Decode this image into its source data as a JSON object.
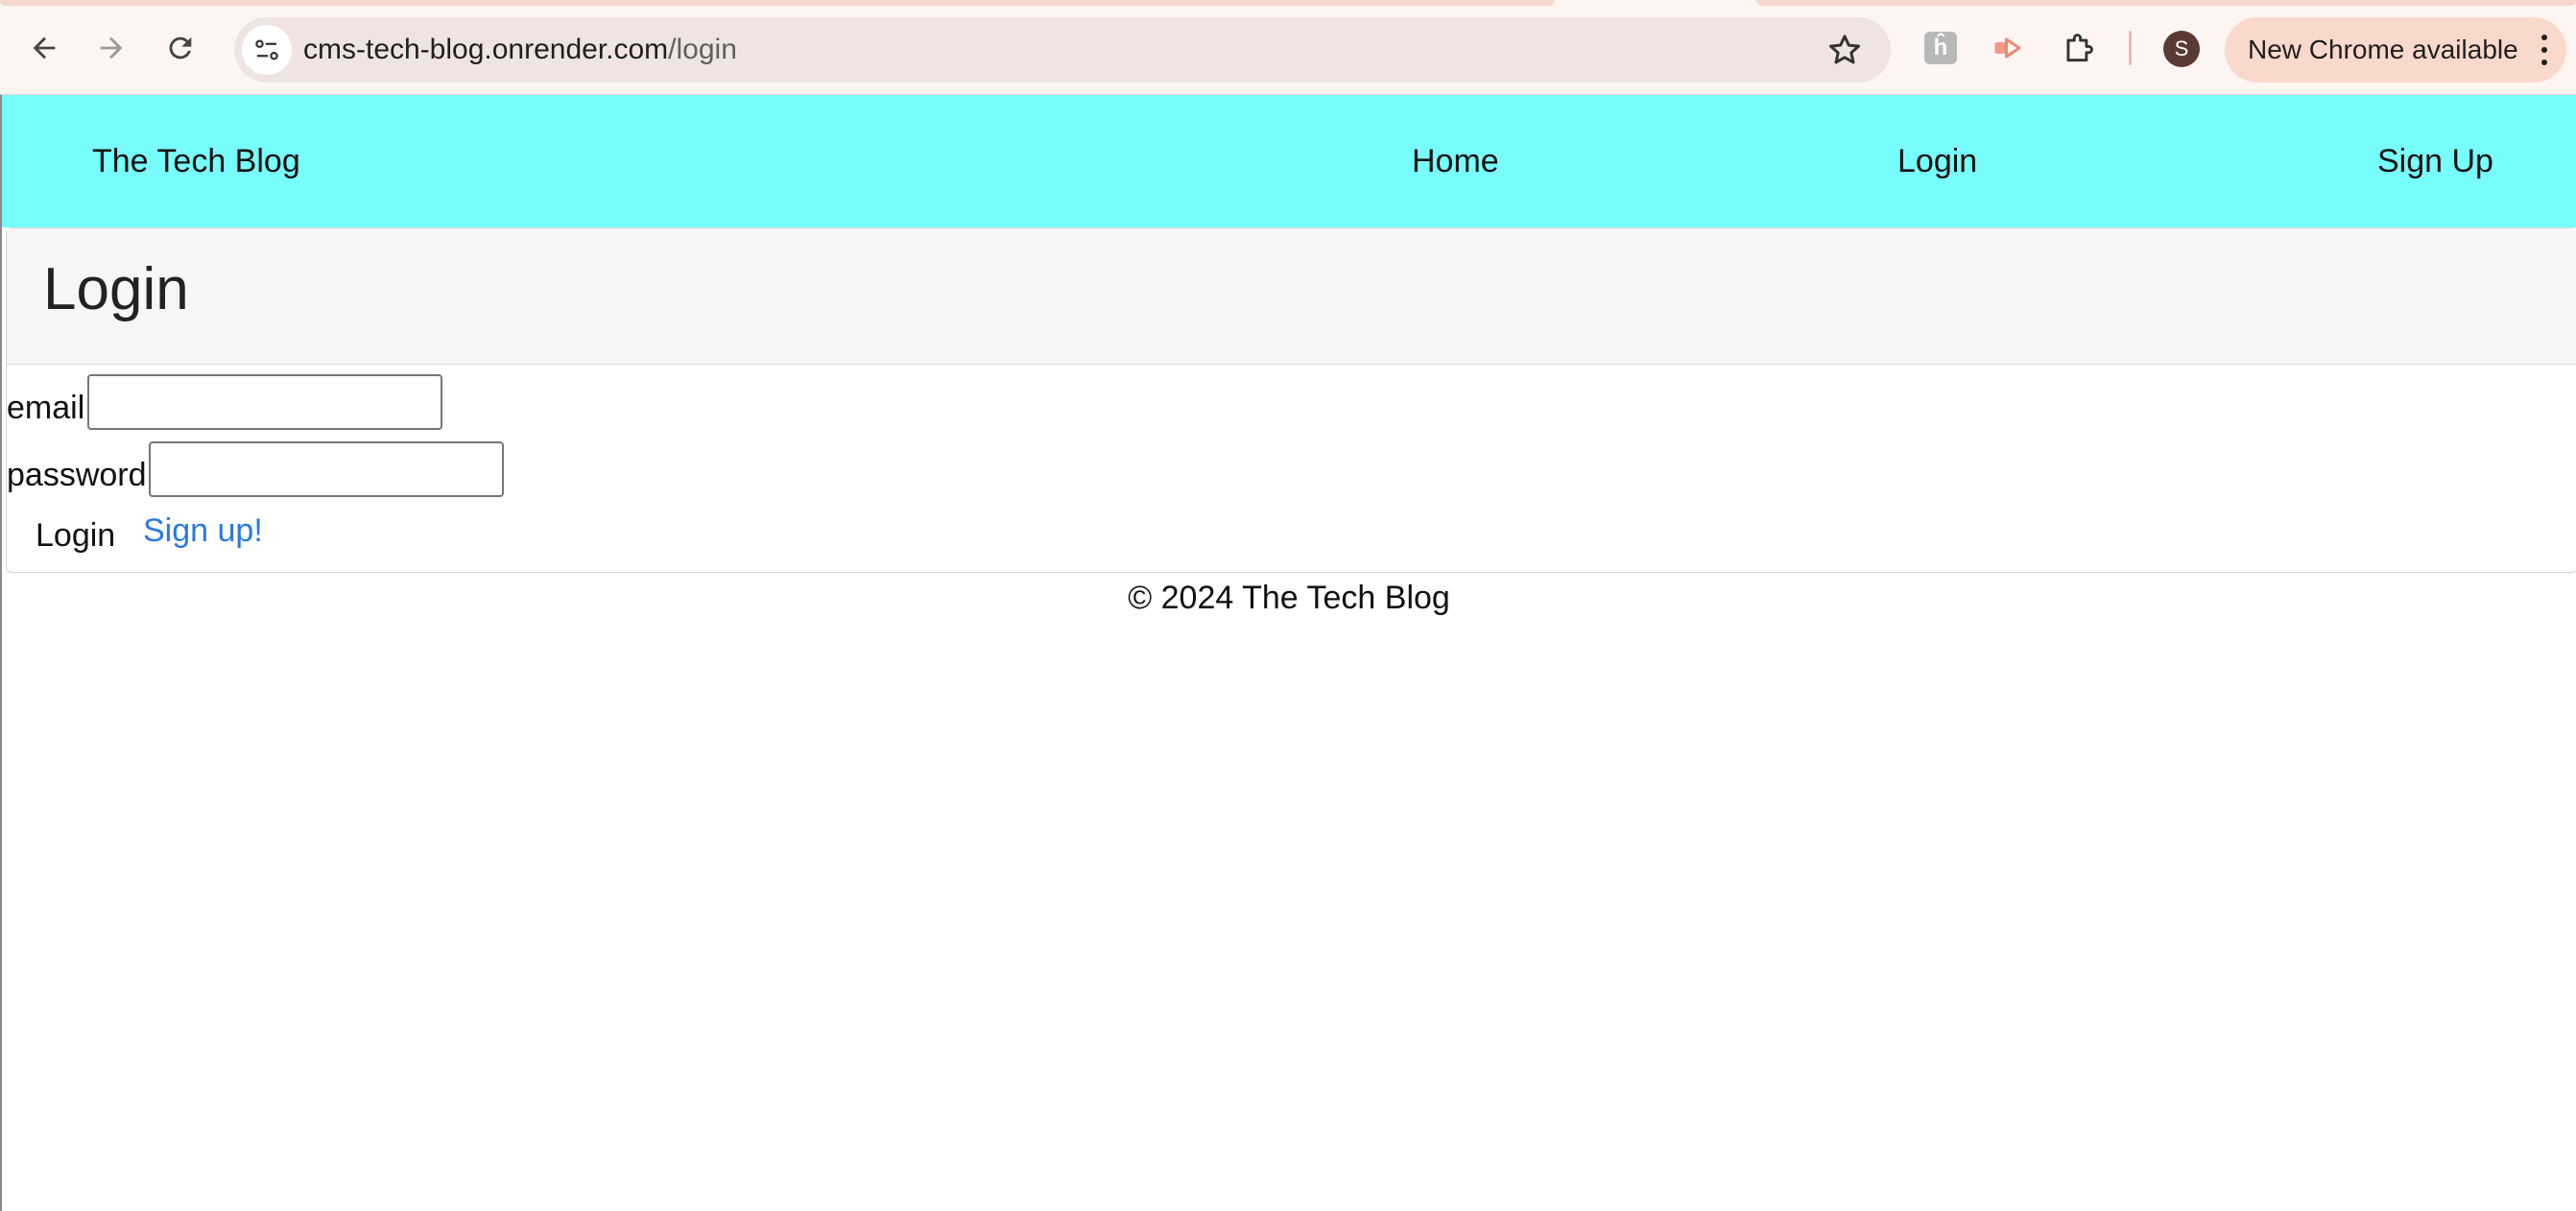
{
  "browser": {
    "url_host": "cms-tech-blog.onrender.com",
    "url_path": "/login",
    "profile_initial": "S",
    "update_label": "New Chrome available",
    "icons": [
      "back-arrow-icon",
      "forward-arrow-icon",
      "reload-icon",
      "site-info-icon",
      "star-icon",
      "extension-h-icon",
      "extension-arrow-icon",
      "puzzle-icon",
      "kebab-menu-icon"
    ],
    "colors": {
      "chrome_bg": "#fdf5f2",
      "omnibox_bg": "#f0e4e2",
      "update_pill_bg": "#f9d9cc",
      "avatar_bg": "#5a3a34"
    }
  },
  "navbar": {
    "brand": "The Tech Blog",
    "links": [
      "Home",
      "Login",
      "Sign Up"
    ],
    "background": "#77fdfc"
  },
  "login_card": {
    "title": "Login",
    "email_label": "email",
    "email_value": "",
    "password_label": "password",
    "password_value": "",
    "submit_label": "Login",
    "signup_link": "Sign up!",
    "link_color": "#2a7ae2"
  },
  "footer": {
    "text": "© 2024 The Tech Blog"
  }
}
